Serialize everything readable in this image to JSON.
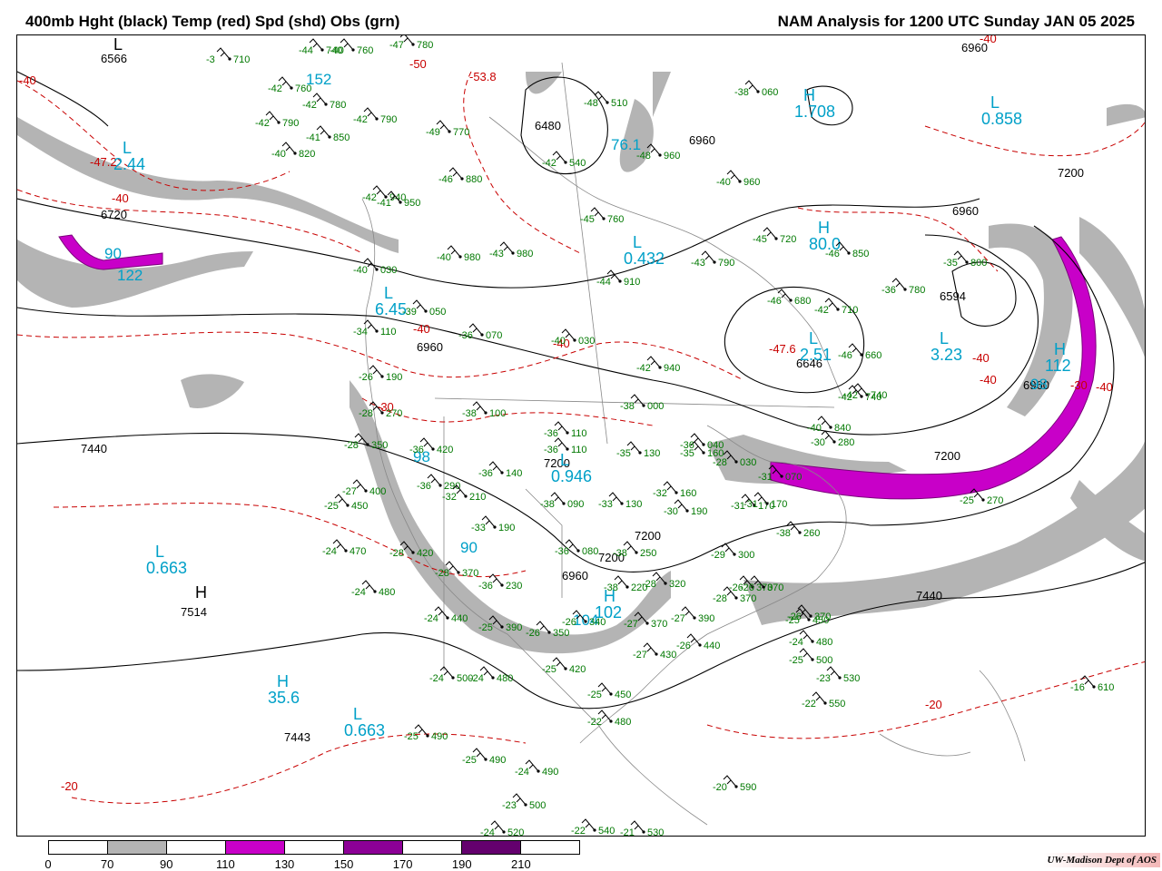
{
  "header": {
    "left_title": "400mb Hght (black) Temp (red) Spd (shd) Obs (grn)",
    "right_title": "NAM Analysis for 1200 UTC Sunday  JAN 05 2025"
  },
  "legend": {
    "ticks": [
      "0",
      "70",
      "90",
      "110",
      "130",
      "150",
      "170",
      "190",
      "210"
    ],
    "colors": [
      "#ffffff",
      "#b4b4b4",
      "#ffffff",
      "#c800c8",
      "#ffffff",
      "#8c0096",
      "#ffffff",
      "#64006e",
      "#ffffff"
    ]
  },
  "credit": "UW-Madison  Dept of AOS",
  "colors": {
    "height_contour": "#000000",
    "temp_contour": "#c80000",
    "obs": "#007800",
    "speed_label": "#00a0c8",
    "speed_70_90": "#b4b4b4",
    "speed_110_130": "#c800c8",
    "geography": "#888888"
  },
  "height_labels": [
    "6566",
    "6720",
    "6960",
    "7200",
    "7440",
    "6480",
    "6960",
    "6960",
    "6594",
    "6646",
    "6960",
    "6960",
    "7200",
    "7200",
    "7440",
    "7514",
    "7443",
    "7200",
    "6960",
    "7200"
  ],
  "temp_labels": [
    "-40",
    "-47.2",
    "-40",
    "-50",
    "-53.8",
    "-40",
    "-40",
    "-47.6",
    "-40",
    "-40",
    "-40",
    "-30",
    "-20",
    "-20",
    "-30",
    "-40"
  ],
  "pressure_centers": [
    {
      "type": "L",
      "value": "6566"
    },
    {
      "type": "L",
      "value": "2.44"
    },
    {
      "type": "L",
      "value": "0.858"
    },
    {
      "type": "H",
      "value": "1.708"
    },
    {
      "type": "L",
      "value": "0.432"
    },
    {
      "type": "H",
      "value": "80.0"
    },
    {
      "type": "L",
      "value": "3.23"
    },
    {
      "type": "H",
      "value": "112"
    },
    {
      "type": "L",
      "value": "2.51"
    },
    {
      "type": "L",
      "value": "0.946"
    },
    {
      "type": "L",
      "value": "0.663"
    },
    {
      "type": "H",
      "value": "7514"
    },
    {
      "type": "H",
      "value": "35.6"
    },
    {
      "type": "L",
      "value": "0.663"
    },
    {
      "type": "L",
      "value": "6.45"
    },
    {
      "type": "H",
      "value": "102"
    }
  ],
  "speed_labels": [
    "152",
    "90",
    "122",
    "76.1",
    "104",
    "98",
    "90",
    "98"
  ],
  "observations": [
    "-44 740",
    "-40 760",
    "-47 780",
    "-3 710",
    "-42 760",
    "-42 780",
    "-42 790",
    "-42 790",
    "-41 850",
    "-40 820",
    "-49 770",
    "-42 940",
    "-41 950",
    "-46 880",
    "-42 540",
    "-48 510",
    "-48 960",
    "-40 960",
    "-38 060",
    "-45 760",
    "-40 980",
    "-43 980",
    "-44 910",
    "-43 790",
    "-45 720",
    "-46 850",
    "-35 800",
    "-40 030",
    "-39 050",
    "-36 070",
    "-34 110",
    "-40 030",
    "-46 680",
    "-42 710",
    "-36 780",
    "-42 940",
    "-46 660",
    "-38 000",
    "-42 740",
    "-42 740",
    "-38 100",
    "-36 110",
    "-26 190",
    "-28 270",
    "-40 840",
    "-36 110",
    "-35 130",
    "-35 160",
    "-28 350",
    "-36 420",
    "-36 140",
    "-36 040",
    "-30 280",
    "-27 400",
    "-36 290",
    "-32 210",
    "-38 090",
    "-33 130",
    "-32 160",
    "-28 030",
    "-31 070",
    "-25 450",
    "-33 190",
    "-31 170",
    "-36 080",
    "-30 190",
    "-31 170",
    "-25 270",
    "-24 470",
    "-28 420",
    "-38 250",
    "-29 300",
    "-38 260",
    "-28 370",
    "-36 230",
    "-38 220",
    "-28 320",
    "-26 370",
    "-24 480",
    "-24 440",
    "-25 390",
    "-26 350",
    "-26 340",
    "-27 370",
    "-27 390",
    "-28 370",
    "-26 370",
    "-26 370",
    "-24 500",
    "-24 480",
    "-25 420",
    "-27 430",
    "-26 440",
    "-25 450",
    "-24 480",
    "-25 500",
    "-25 490",
    "-25 450",
    "-22 480",
    "-23 530",
    "-22 550",
    "-16 610",
    "-25 490",
    "-24 490",
    "-23 500",
    "-20 590",
    "-24 520",
    "-22 540",
    "-21 530"
  ]
}
